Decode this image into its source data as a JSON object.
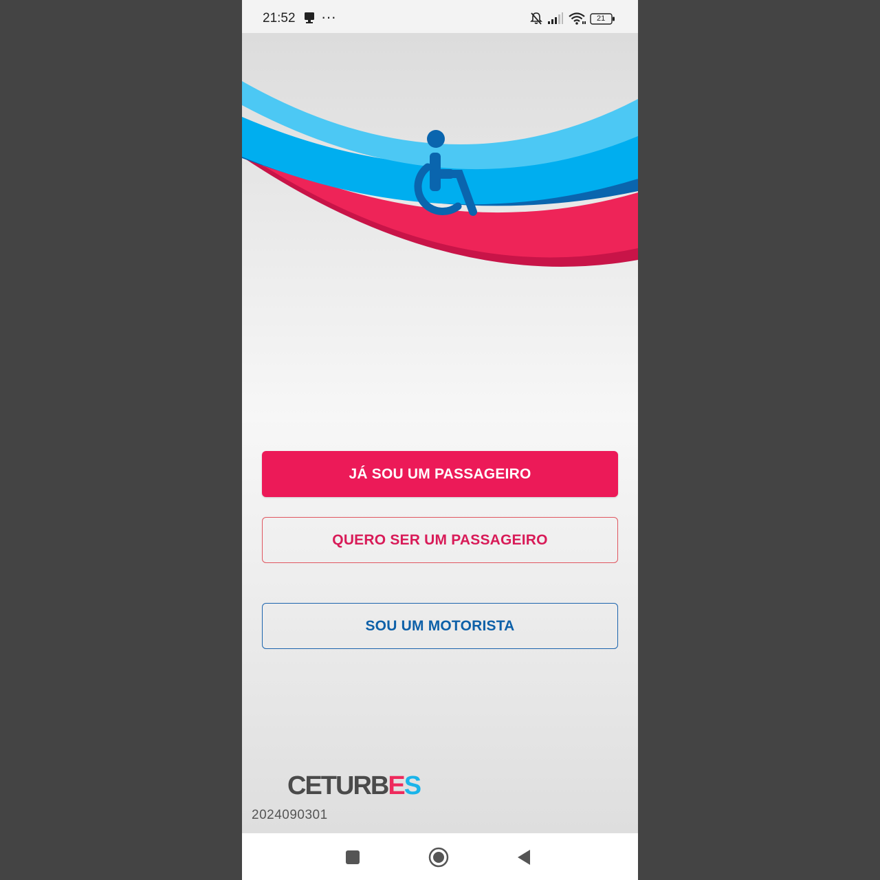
{
  "status_bar": {
    "time": "21:52",
    "overflow": "···",
    "battery": "21",
    "icons": [
      "notification-icon",
      "overflow-dots-icon",
      "mute-bell-icon",
      "cell-signal-icon",
      "wifi-icon",
      "battery-icon"
    ]
  },
  "hero": {
    "icon": "wheelchair-icon",
    "colors": {
      "light_blue": "#4cc8f4",
      "blue": "#00aeef",
      "dark_blue": "#0a65ae",
      "red": "#ee2458",
      "dark_red": "#c81448"
    }
  },
  "buttons": {
    "passenger": "JÁ SOU UM PASSAGEIRO",
    "become_passenger": "QUERO SER UM PASSAGEIRO",
    "driver": "SOU UM MOTORISTA"
  },
  "brand": {
    "logo_main": "CETURB",
    "logo_e": "E",
    "logo_s": "S"
  },
  "version": "2024090301",
  "nav_bar": {
    "icons": [
      "recents-square-icon",
      "home-circle-icon",
      "back-triangle-icon"
    ]
  },
  "accent_colors": {
    "primary": "#ec1a58",
    "secondary": "#0d60a8"
  }
}
